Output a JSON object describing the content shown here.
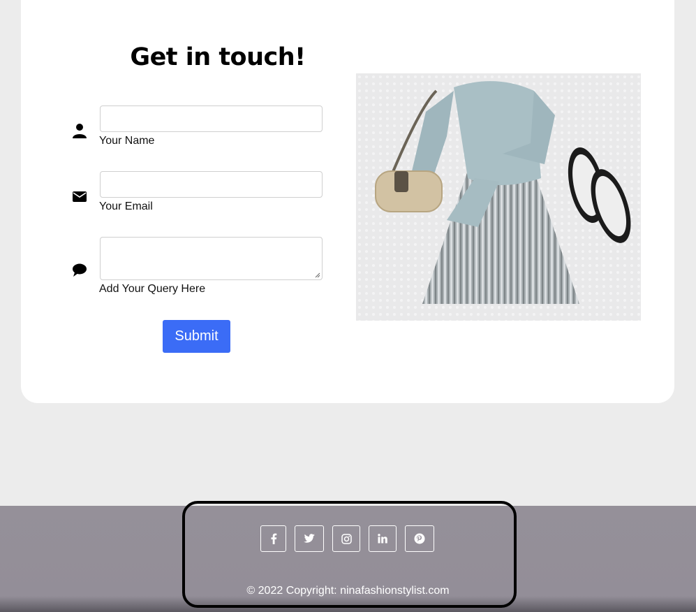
{
  "contact": {
    "title": "Get in touch!",
    "fields": [
      {
        "label": "Your Name",
        "icon": "person-icon",
        "value": ""
      },
      {
        "label": "Your Email",
        "icon": "envelope-icon",
        "value": ""
      },
      {
        "label": "Add Your Query Here",
        "icon": "speech-bubble-icon",
        "value": ""
      }
    ],
    "submit_label": "Submit",
    "submit_color": "#3b6cf6"
  },
  "image": {
    "subject": "Outfit flat lay: light blue sweater, silver pleated skirt, wicker bag, espadrilles"
  },
  "footer": {
    "social_icons": [
      "facebook-icon",
      "twitter-icon",
      "instagram-icon",
      "linkedin-icon",
      "pinterest-icon"
    ],
    "copyright": "© 2022 Copyright: ninafashionstylist.com",
    "background": "#958f99"
  }
}
